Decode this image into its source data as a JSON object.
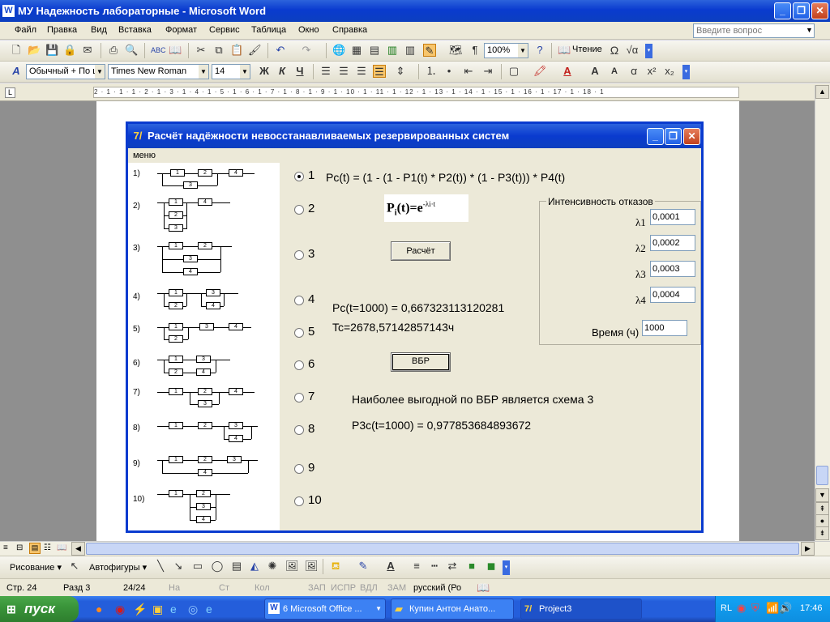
{
  "word": {
    "title": "МУ Надежность лабораторные - Microsoft Word",
    "menu": [
      "Файл",
      "Правка",
      "Вид",
      "Вставка",
      "Формат",
      "Сервис",
      "Таблица",
      "Окно",
      "Справка"
    ],
    "ask_placeholder": "Введите вопрос",
    "zoom": "100%",
    "read_label": "Чтение",
    "style": "Обычный + По ц",
    "font": "Times New Roman",
    "font_size": "14",
    "ruler_text": "2 · 1 · 1 · 1 · 2 · 1 · 3 · 1 · 4 · 1 · 5 · 1 · 6 · 1 · 7 · 1 · 8 · 1 · 9 · 1 · 10 · 1 · 11 · 1 · 12 · 1 · 13 · 1 · 14 · 1 · 15 · 1 · 16 · 1 · 17 · 1 · 18 · 1"
  },
  "app": {
    "title": "Расчёт надёжности невосстанавливаемых резервированных систем",
    "menu": "меню",
    "scheme_numbers": [
      "1)",
      "2)",
      "3)",
      "4)",
      "5)",
      "6)",
      "7)",
      "8)",
      "9)",
      "10)"
    ],
    "radio_labels": [
      "1",
      "2",
      "3",
      "4",
      "5",
      "6",
      "7",
      "8",
      "9",
      "10"
    ],
    "selected_radio": "1",
    "formula": "Pc(t) = (1 - (1 - P1(t) * P2(t)) * (1 - P3(t))) * P4(t)",
    "pi_formula": {
      "base": "P",
      "sub": "i",
      "rest": "(t)=e",
      "sup": "-λi·t"
    },
    "calc_button": "Расчёт",
    "result_pc": "Pc(t=1000) = 0,667323113120281",
    "result_tc": "Tc=2678,57142857143ч",
    "vbr_button": "ВБР",
    "best_scheme": "Наиболее выгодной по ВБР является схема 3",
    "best_value": "P3c(t=1000) = 0,977853684893672",
    "group_title": "Интенсивность отказов",
    "lambdas": [
      {
        "label": "λ1",
        "value": "0,0001"
      },
      {
        "label": "λ2",
        "value": "0,0002"
      },
      {
        "label": "λ3",
        "value": "0,0003"
      },
      {
        "label": "λ4",
        "value": "0,0004"
      }
    ],
    "time_label": "Время (ч)",
    "time_value": "1000"
  },
  "drawbar": {
    "draw": "Рисование ▾",
    "autoshapes": "Автофигуры ▾"
  },
  "status": {
    "page": "Стр. 24",
    "section": "Разд 3",
    "pages": "24/24",
    "at": "На",
    "ln": "Ст",
    "col": "Кол",
    "rec": "ЗАП",
    "trk": "ИСПР",
    "ext": "ВДЛ",
    "ovr": "ЗАМ",
    "lang": "русский (Ро"
  },
  "taskbar": {
    "start": "пуск",
    "tasks": [
      "6 Microsoft Office ...",
      "Купин Антон Анато...",
      "Project3"
    ],
    "lang": "RL",
    "clock": "17:46"
  }
}
